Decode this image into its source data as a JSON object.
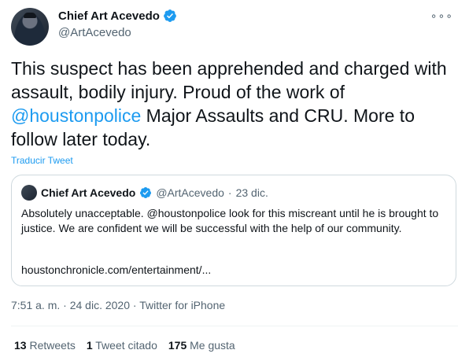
{
  "author": {
    "name": "Chief Art Acevedo",
    "handle": "@ArtAcevedo"
  },
  "icons": {
    "verified": "verified-badge-icon",
    "more": "more-options-icon"
  },
  "tweet": {
    "text_before": "This suspect has been apprehended and charged with assault, bodily injury. Proud of the work of ",
    "mention": "@houstonpolice",
    "text_after": " Major Assaults and CRU. More to follow later today.",
    "translate_label": "Traducir Tweet"
  },
  "quote": {
    "name": "Chief Art Acevedo",
    "handle": "@ArtAcevedo",
    "separator": "·",
    "date": "23 dic.",
    "text": "Absolutely unacceptable. @houstonpolice look for this miscreant until he is brought to justice. We are confident we will be successful with the help of our community.",
    "link": "houstonchronicle.com/entertainment/..."
  },
  "meta": {
    "time": "7:51 a. m.",
    "date": "24 dic. 2020",
    "source": "Twitter for iPhone",
    "sep": "·"
  },
  "stats": {
    "retweets_count": "13",
    "retweets_label": "Retweets",
    "quotes_count": "1",
    "quotes_label": "Tweet citado",
    "likes_count": "175",
    "likes_label": "Me gusta"
  },
  "colors": {
    "accent": "#1d9bf0",
    "text": "#0f1419",
    "muted": "#536471",
    "border": "#cfd9de"
  }
}
